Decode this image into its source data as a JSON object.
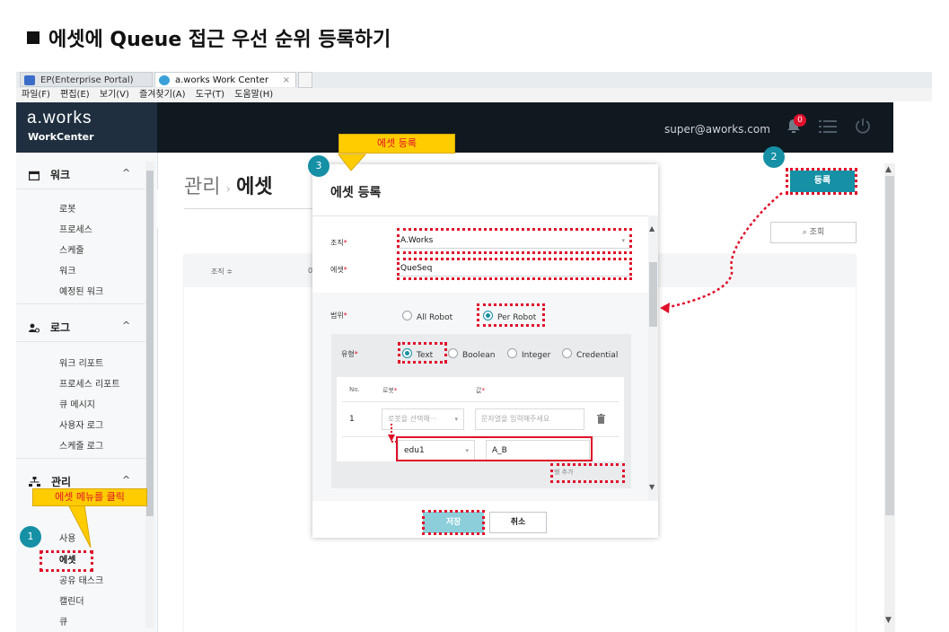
{
  "heading": "에셋에 Queue 접근 우선 순위 등록하기",
  "browser": {
    "tab1": "EP(Enterprise Portal)",
    "tab2": "a.works Work Center",
    "tab_close": "×",
    "menus": [
      "파일(F)",
      "편집(E)",
      "보기(V)",
      "즐겨찾기(A)",
      "도구(T)",
      "도움말(H)"
    ]
  },
  "app": {
    "logo": "a.works",
    "logo_sub": "WorkCenter",
    "user": "super@aworks.com",
    "notification_count": "0"
  },
  "sidebar": {
    "sections": [
      {
        "label": "워크",
        "items": [
          "로봇",
          "프로세스",
          "스케줄",
          "워크",
          "예정된 워크"
        ]
      },
      {
        "label": "로그",
        "items": [
          "워크 리포트",
          "프로세스 리포트",
          "큐 메시지",
          "사용자 로그",
          "스케줄 로그"
        ]
      },
      {
        "label": "관리",
        "items": [
          "사용",
          "에셋",
          "공유 태스크",
          "캘린더",
          "큐"
        ]
      }
    ],
    "caret": "^"
  },
  "main": {
    "breadcrumb_parent": "관리",
    "breadcrumb_sep": "›",
    "breadcrumb_current": "에셋",
    "register_button": "등록",
    "search_button": "조회",
    "table_col1": "조직 ≑",
    "table_col2": "0"
  },
  "modal": {
    "title": "에셋 등록",
    "org_label": "조직",
    "org_value": "A.Works",
    "asset_label": "에셋",
    "asset_value": "QueSeq",
    "scope_label": "범위",
    "scope_options": [
      "All Robot",
      "Per Robot"
    ],
    "scope_selected": "Per Robot",
    "type_label": "유형",
    "type_options": [
      "Text",
      "Boolean",
      "Integer",
      "Credential"
    ],
    "type_selected": "Text",
    "col_no": "No.",
    "col_robot": "로봇",
    "col_value": "값",
    "row1_no": "1",
    "row1_robot_placeholder": "로봇을 선택해···",
    "row1_value_placeholder": "문자열을 입력해주세요",
    "row2_robot": "edu1",
    "row2_value": "A_B",
    "add_row": "행 추가",
    "save_button": "저장",
    "cancel_button": "취소",
    "required_mark": "*"
  },
  "annotations": {
    "callout_menu": "에셋 메뉴를 클릭",
    "callout_register": "에셋 등록",
    "step1": "1",
    "step2": "2",
    "step3": "3"
  },
  "colors": {
    "accent": "#1590a5",
    "annotation_red": "#e0102a",
    "callout_yellow": "#ffcc00",
    "topbar": "#101820"
  }
}
